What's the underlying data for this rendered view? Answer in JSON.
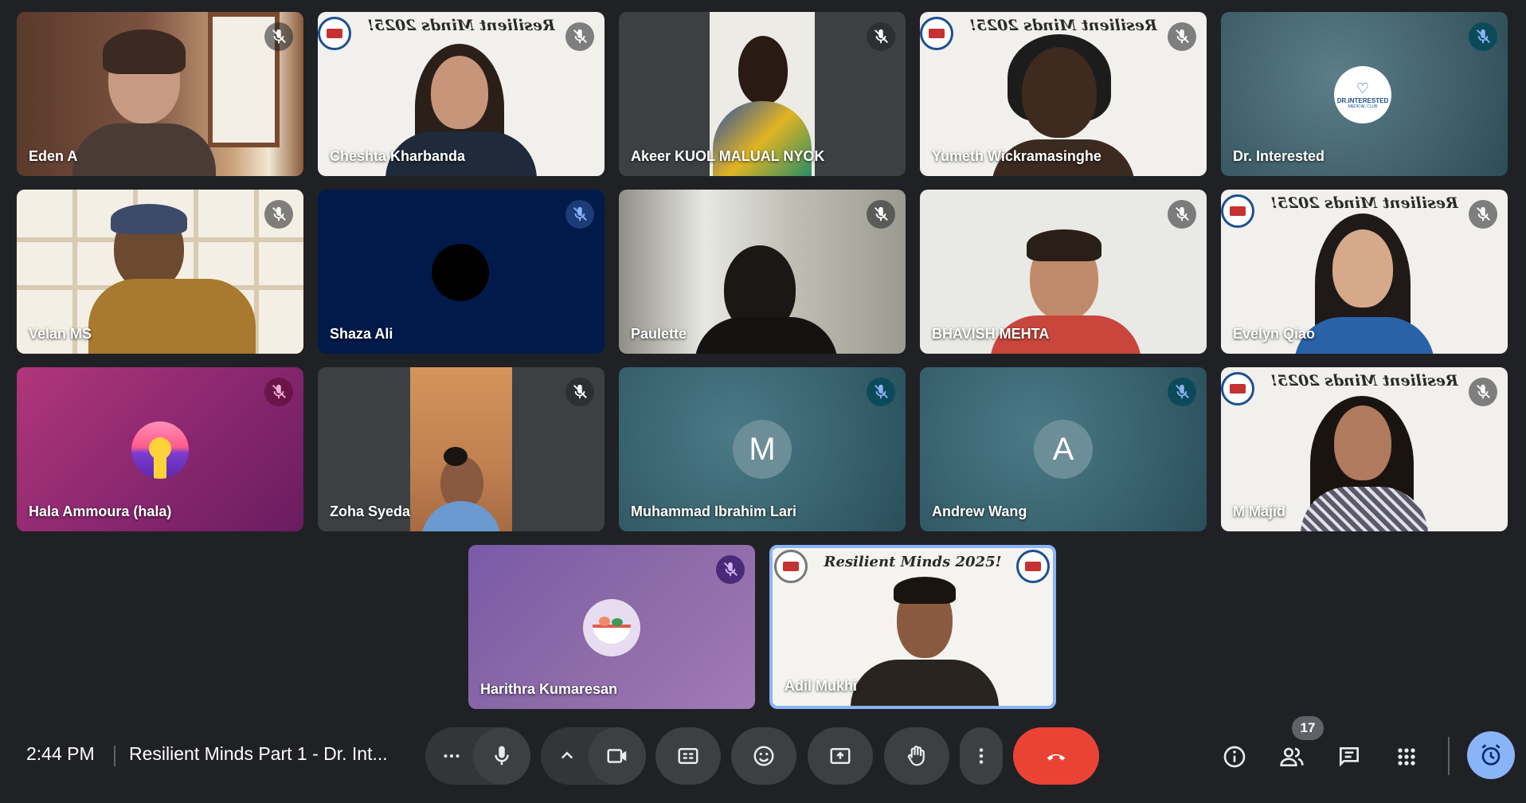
{
  "participants": [
    {
      "name": "Eden A"
    },
    {
      "name": "Cheshta Kharbanda"
    },
    {
      "name": "Akeer KUOL MALUAL NYOK"
    },
    {
      "name": "Yumeth Wickramasinghe"
    },
    {
      "name": "Dr. Interested"
    },
    {
      "name": "Velan MS"
    },
    {
      "name": "Shaza Ali"
    },
    {
      "name": "Paulette"
    },
    {
      "name": "BHAVISH MEHTA"
    },
    {
      "name": "Evelyn Qiao"
    },
    {
      "name": "Hala Ammoura (hala)"
    },
    {
      "name": "Zoha Syeda"
    },
    {
      "name": "Muhammad Ibrahim Lari",
      "avatar_letter": "M"
    },
    {
      "name": "Andrew Wang",
      "avatar_letter": "A"
    },
    {
      "name": "M Majid"
    },
    {
      "name": "Harithra Kumaresan"
    },
    {
      "name": "Adil Mukhi"
    }
  ],
  "banner_text": "Resilient Minds 2025!",
  "club_logo_text": "DR.INTERESTED",
  "club_logo_subtext": "MEDICAL CLUB",
  "meeting": {
    "time": "2:44 PM",
    "title": "Resilient Minds Part 1 - Dr. Int..."
  },
  "people_count": "17",
  "colors": {
    "background": "#202124",
    "control": "#3c4043",
    "end_call": "#ea4335",
    "active_speaker_border": "#8ab4f8",
    "activity_button": "#8ab4f8"
  },
  "controls": {
    "more_options_icon": "more-horizontal-icon",
    "mic_icon": "mic-icon",
    "expand_icon": "chevron-up-icon",
    "camera_icon": "camera-icon",
    "captions_icon": "captions-icon",
    "emoji_icon": "emoji-icon",
    "present_icon": "present-screen-icon",
    "raise_hand_icon": "hand-icon",
    "more_vertical_icon": "more-vertical-icon",
    "leave_icon": "phone-hangup-icon",
    "info_icon": "info-icon",
    "people_icon": "people-icon",
    "chat_icon": "chat-icon",
    "activities_icon": "apps-grid-icon",
    "timer_icon": "alarm-icon"
  }
}
